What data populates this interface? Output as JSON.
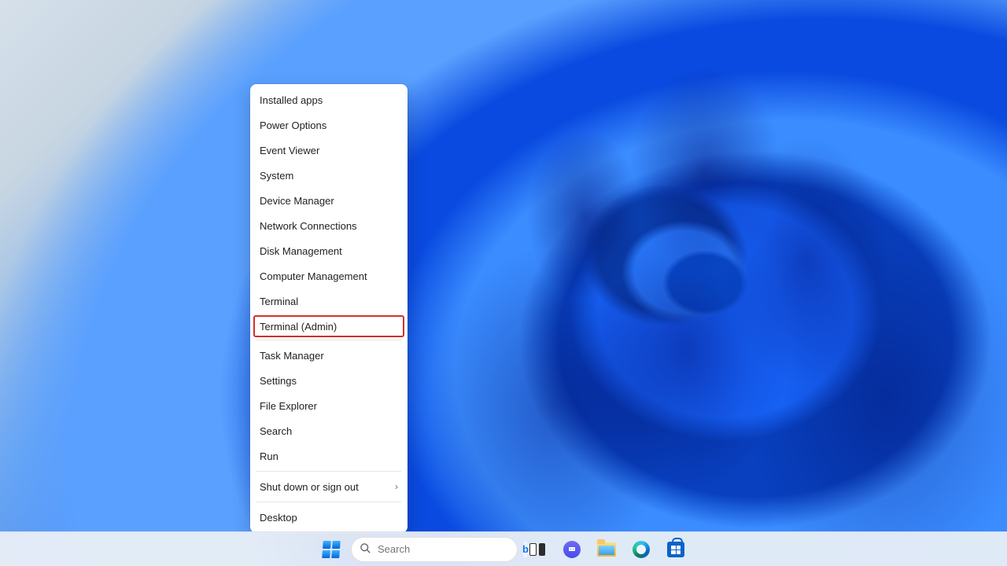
{
  "context_menu": {
    "groups": [
      [
        {
          "label": "Installed apps",
          "name": "menu-installed-apps"
        },
        {
          "label": "Power Options",
          "name": "menu-power-options"
        },
        {
          "label": "Event Viewer",
          "name": "menu-event-viewer"
        },
        {
          "label": "System",
          "name": "menu-system"
        },
        {
          "label": "Device Manager",
          "name": "menu-device-manager"
        },
        {
          "label": "Network Connections",
          "name": "menu-network-connections"
        },
        {
          "label": "Disk Management",
          "name": "menu-disk-management"
        },
        {
          "label": "Computer Management",
          "name": "menu-computer-management"
        },
        {
          "label": "Terminal",
          "name": "menu-terminal"
        },
        {
          "label": "Terminal (Admin)",
          "name": "menu-terminal-admin",
          "highlighted": true
        }
      ],
      [
        {
          "label": "Task Manager",
          "name": "menu-task-manager"
        },
        {
          "label": "Settings",
          "name": "menu-settings"
        },
        {
          "label": "File Explorer",
          "name": "menu-file-explorer"
        },
        {
          "label": "Search",
          "name": "menu-search"
        },
        {
          "label": "Run",
          "name": "menu-run"
        }
      ],
      [
        {
          "label": "Shut down or sign out",
          "name": "menu-shutdown-signout",
          "submenu": true
        }
      ],
      [
        {
          "label": "Desktop",
          "name": "menu-desktop"
        }
      ]
    ]
  },
  "taskbar": {
    "search_placeholder": "Search",
    "bing_badge": "b",
    "icons": [
      {
        "name": "start-button",
        "type": "start"
      },
      {
        "name": "search-box",
        "type": "search"
      },
      {
        "name": "task-view-button",
        "type": "taskview"
      },
      {
        "name": "chat-button",
        "type": "chat"
      },
      {
        "name": "file-explorer-button",
        "type": "folder"
      },
      {
        "name": "edge-button",
        "type": "edge"
      },
      {
        "name": "microsoft-store-button",
        "type": "store"
      }
    ]
  },
  "annotation": {
    "highlight_color": "#d3302a"
  }
}
